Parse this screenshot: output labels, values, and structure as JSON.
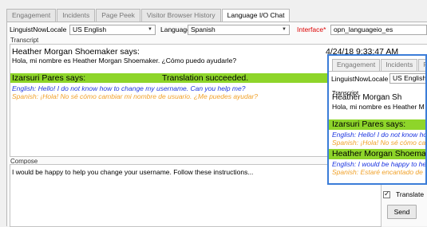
{
  "tabs": [
    {
      "label": "Engagement",
      "active": false
    },
    {
      "label": "Incidents",
      "active": false
    },
    {
      "label": "Page Peek",
      "active": false
    },
    {
      "label": "Visitor Browser History",
      "active": false
    },
    {
      "label": "Language I/O Chat",
      "active": true
    }
  ],
  "toolbar": {
    "locale_label": "LinguistNowLocale",
    "locale_value": "US English",
    "language_label": "Language",
    "language_value": "Spanish",
    "interface_label": "Interface",
    "interface_required": "*",
    "interface_value": "opn_languageio_es"
  },
  "transcript": {
    "label": "Transcript",
    "timestamp": "4/24/18 9:33:47 AM",
    "agent_name": "Heather Morgan Shoemaker says:",
    "agent_msg": "Hola, mi nombre es Heather Morgan Shoemaker. ¿Cómo puedo ayudarle?",
    "visitor_name": "Izarsuri Pares says:",
    "visitor_status": "Translation succeeded.",
    "visitor_en": "English: Hello! I do not know how to change my username. Can you help me?",
    "visitor_es": "Spanish: ¡Hola! No sé cómo cambiar mi nombre de usuario. ¿Me puedes ayudar?"
  },
  "compose": {
    "label": "Compose",
    "text": "I would be happy to help you change your username.  Follow these instructions..."
  },
  "translate": {
    "label": "Translate",
    "checked": true
  },
  "send_label": "Send",
  "popup": {
    "tabs": [
      "Engagement",
      "Incidents",
      "Pa"
    ],
    "locale_label": "LinguistNowLocale",
    "locale_value": "US English",
    "transcript_label": "Transcript",
    "agent_name_cut": "Heather Morgan Sh",
    "agent_msg": "Hola, mi nombre es Heather M",
    "visitor_name": "Izarsuri Pares says:",
    "visitor_en": "English: Hello! I do not know ho",
    "visitor_es": "Spanish: ¡Hola! No sé cómo ca",
    "agent_name": "Heather Morgan Shoemak",
    "agent_en": "English: I would be happy to he",
    "agent_es": "Spanish: Estaré encantado de"
  },
  "colors": {
    "highlight_green": "#8ed52a",
    "english_blue": "#1b34e0",
    "spanish_orange": "#f0a12a",
    "popup_border": "#3b7dd8",
    "required_red": "#dd0000"
  }
}
